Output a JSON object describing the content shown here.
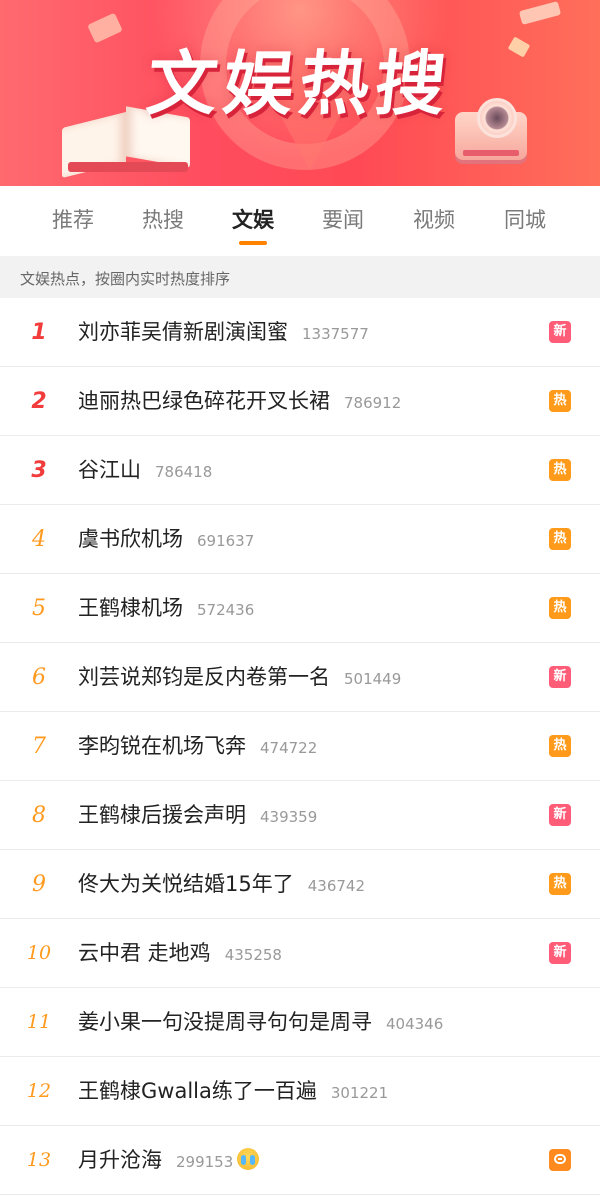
{
  "banner": {
    "title": "文娱热搜"
  },
  "tabs": [
    {
      "label": "推荐",
      "active": false
    },
    {
      "label": "热搜",
      "active": false
    },
    {
      "label": "文娱",
      "active": true
    },
    {
      "label": "要闻",
      "active": false
    },
    {
      "label": "视频",
      "active": false
    },
    {
      "label": "同城",
      "active": false
    }
  ],
  "subheader": {
    "text": "文娱热点，按圈内实时热度排序"
  },
  "colors": {
    "accent": "#ff8200",
    "rank_top": "#f23b3b",
    "rank_other": "#ff9a1f",
    "badge_new": "#ff5c78",
    "badge_hot": "#ff9a1a"
  },
  "items": [
    {
      "rank": "1",
      "title": "刘亦菲吴倩新剧演闺蜜",
      "heat": "1337577",
      "badge": "新",
      "badge_type": "new"
    },
    {
      "rank": "2",
      "title": "迪丽热巴绿色碎花开叉长裙",
      "heat": "786912",
      "badge": "热",
      "badge_type": "hot"
    },
    {
      "rank": "3",
      "title": "谷江山",
      "heat": "786418",
      "badge": "热",
      "badge_type": "hot"
    },
    {
      "rank": "4",
      "title": "虞书欣机场",
      "heat": "691637",
      "badge": "热",
      "badge_type": "hot"
    },
    {
      "rank": "5",
      "title": "王鹤棣机场",
      "heat": "572436",
      "badge": "热",
      "badge_type": "hot"
    },
    {
      "rank": "6",
      "title": "刘芸说郑钧是反内卷第一名",
      "heat": "501449",
      "badge": "新",
      "badge_type": "new"
    },
    {
      "rank": "7",
      "title": "李昀锐在机场飞奔",
      "heat": "474722",
      "badge": "热",
      "badge_type": "hot"
    },
    {
      "rank": "8",
      "title": "王鹤棣后援会声明",
      "heat": "439359",
      "badge": "新",
      "badge_type": "new"
    },
    {
      "rank": "9",
      "title": "佟大为关悦结婚15年了",
      "heat": "436742",
      "badge": "热",
      "badge_type": "hot"
    },
    {
      "rank": "10",
      "title": "云中君 走地鸡",
      "heat": "435258",
      "badge": "新",
      "badge_type": "new"
    },
    {
      "rank": "11",
      "title": "姜小果一句没提周寻句句是周寻",
      "heat": "404346",
      "badge": "",
      "badge_type": "none"
    },
    {
      "rank": "12",
      "title": "王鹤棣Gwalla练了一百遍",
      "heat": "301221",
      "badge": "",
      "badge_type": "none"
    },
    {
      "rank": "13",
      "title": "月升沧海",
      "heat": "299153",
      "badge": "",
      "badge_type": "chat",
      "emoji_icon": "crying-face-icon"
    }
  ]
}
